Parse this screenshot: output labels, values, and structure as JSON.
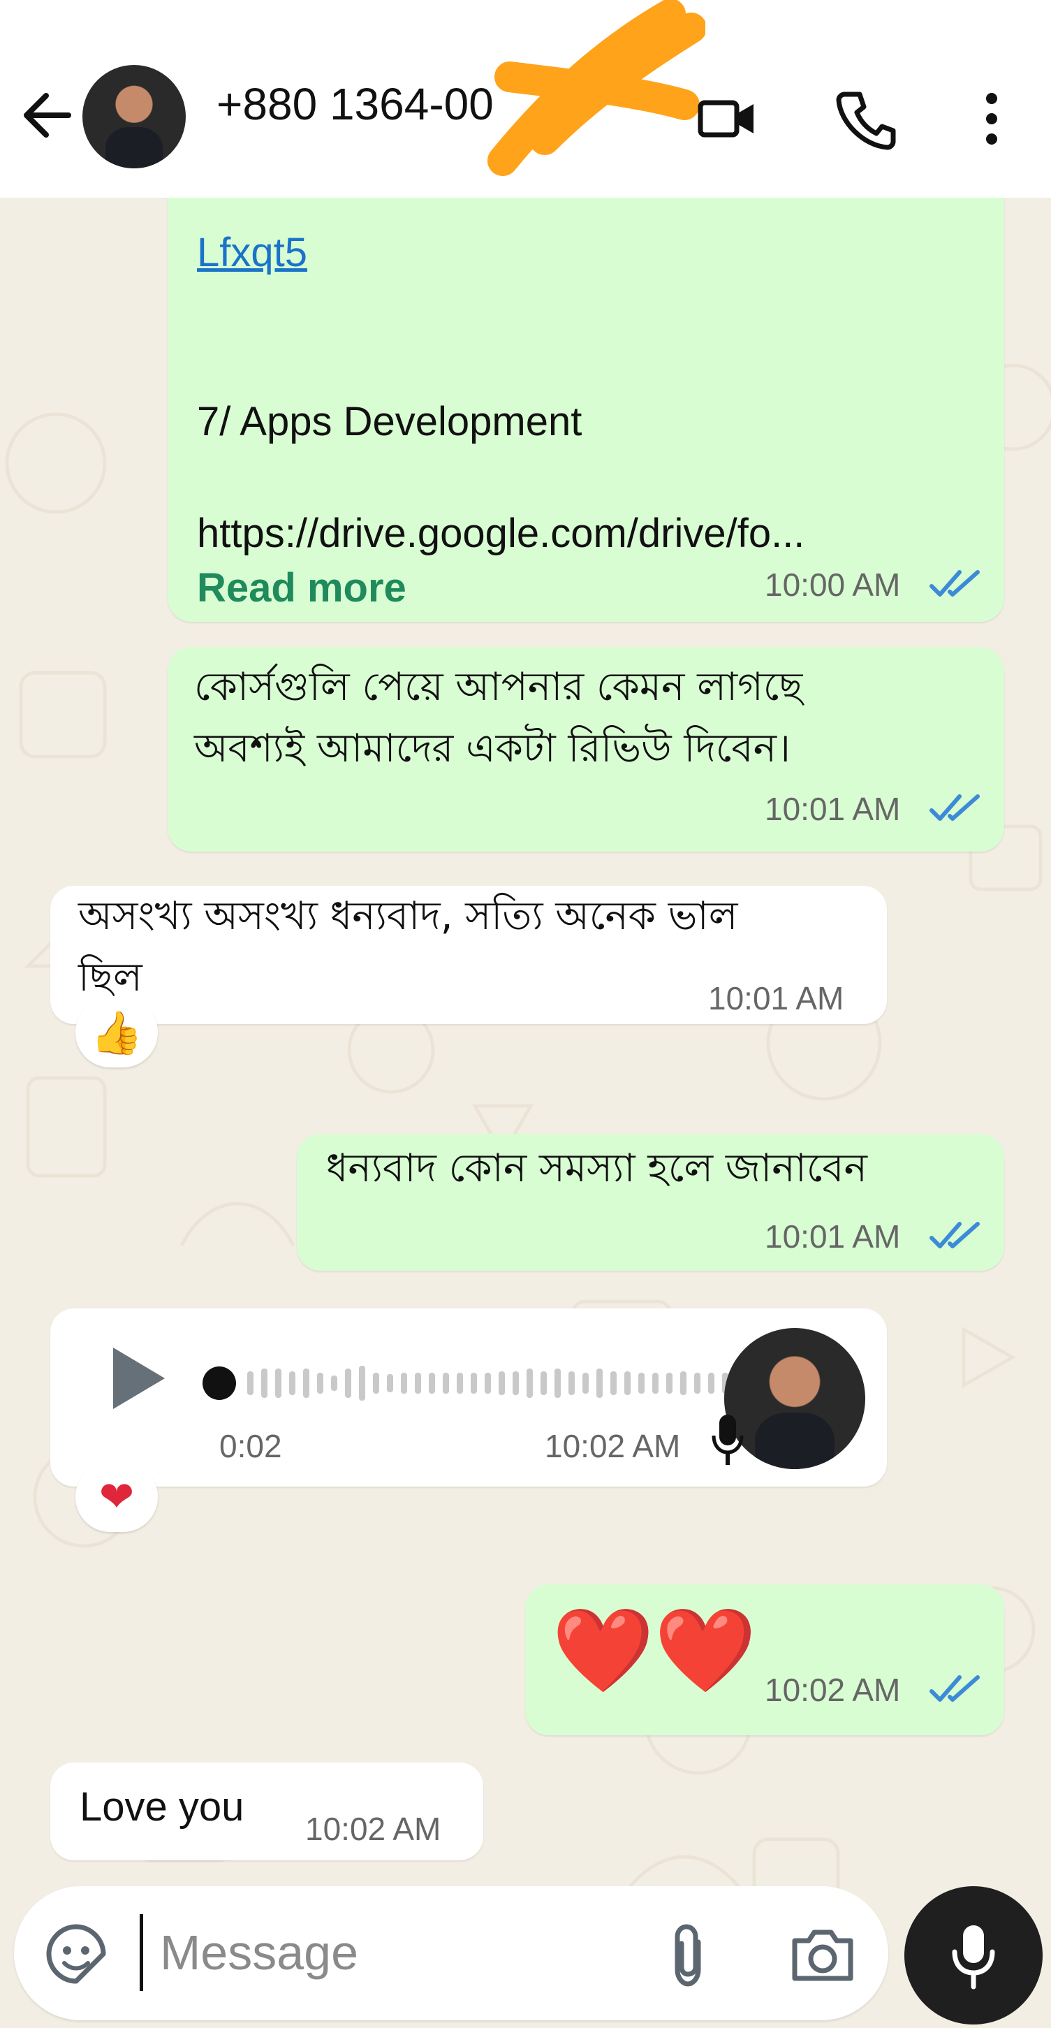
{
  "header": {
    "contact_name": "+880 1364-00",
    "icons": [
      "back-arrow-icon",
      "video-call-icon",
      "voice-call-icon",
      "more-vertical-icon"
    ]
  },
  "messages": {
    "m1": {
      "link_tail": "Lfxqt5",
      "heading": "7/ Apps Development",
      "url": "https://drive.google.com/drive/fo...",
      "read_more": "Read more",
      "time": "10:00 AM"
    },
    "m2": {
      "line1": "কোর্সগুলি পেয়ে আপনার কেমন লাগছে",
      "line2": "অবশ্যই আমাদের একটা রিভিউ দিবেন।",
      "time": "10:01 AM"
    },
    "m3": {
      "line1": "অসংখ্য অসংখ্য ধন্যবাদ, সত্যি অনেক ভাল",
      "line2": "ছিল",
      "time": "10:01 AM",
      "reaction": "👍"
    },
    "m4": {
      "text": "ধন্যবাদ কোন সমস্যা হলে জানাবেন",
      "time": "10:01 AM"
    },
    "m5": {
      "duration": "0:02",
      "time": "10:02 AM",
      "progress": 0,
      "reaction": "❤"
    },
    "m6": {
      "emoji": "❤️❤️",
      "time": "10:02 AM"
    },
    "m7": {
      "text": "Love you",
      "time": "10:02 AM"
    }
  },
  "composer": {
    "placeholder": "Message",
    "icons": [
      "sticker-icon",
      "attach-icon",
      "camera-icon",
      "microphone-icon"
    ]
  },
  "colors": {
    "outgoing_bubble": "#d9fdd3",
    "incoming_bubble": "#ffffff",
    "read_ticks": "#3d8bd6",
    "link": "#1a73c8",
    "read_more": "#1f8a5b",
    "scribble": "#ffa31a"
  }
}
